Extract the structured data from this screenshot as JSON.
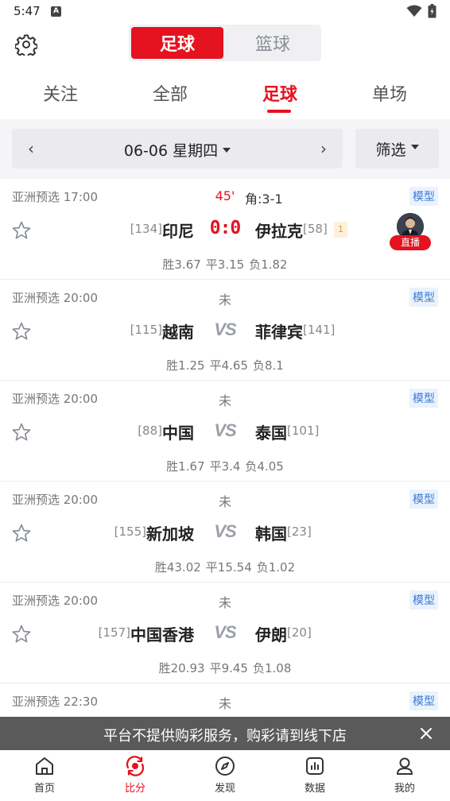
{
  "status_bar": {
    "time": "5:47",
    "notif": "A"
  },
  "header": {
    "sport_toggle": [
      {
        "label": "足球",
        "active": true
      },
      {
        "label": "篮球",
        "active": false
      }
    ]
  },
  "tabs": [
    "关注",
    "全部",
    "足球",
    "单场"
  ],
  "active_tab": "足球",
  "date_bar": {
    "prev": "‹",
    "date": "06-06 星期四",
    "next": "›",
    "filter": "筛选"
  },
  "matches": [
    {
      "league": "亚洲预选 17:00",
      "status": "45'",
      "live": true,
      "corner": "角:3-1",
      "model": "模型",
      "home_rank": "[134]",
      "home": "印尼",
      "score": "0:0",
      "away": "伊拉克",
      "away_rank": "[58]",
      "card": "1",
      "odds": {
        "win": "胜3.67",
        "draw": "平3.15",
        "lose": "负1.82"
      },
      "stream_label": "直播"
    },
    {
      "league": "亚洲预选 20:00",
      "status": "未",
      "model": "模型",
      "home_rank": "[115]",
      "home": "越南",
      "vs": "VS",
      "away": "菲律宾",
      "away_rank": "[141]",
      "odds": {
        "win": "胜1.25",
        "draw": "平4.65",
        "lose": "负8.1"
      }
    },
    {
      "league": "亚洲预选 20:00",
      "status": "未",
      "model": "模型",
      "home_rank": "[88]",
      "home": "中国",
      "vs": "VS",
      "away": "泰国",
      "away_rank": "[101]",
      "odds": {
        "win": "胜1.67",
        "draw": "平3.4",
        "lose": "负4.05"
      }
    },
    {
      "league": "亚洲预选 20:00",
      "status": "未",
      "model": "模型",
      "home_rank": "[155]",
      "home": "新加坡",
      "vs": "VS",
      "away": "韩国",
      "away_rank": "[23]",
      "odds": {
        "win": "胜43.02",
        "draw": "平15.54",
        "lose": "负1.02"
      }
    },
    {
      "league": "亚洲预选 20:00",
      "status": "未",
      "model": "模型",
      "home_rank": "[157]",
      "home": "中国香港",
      "vs": "VS",
      "away": "伊朗",
      "away_rank": "[20]",
      "odds": {
        "win": "胜20.93",
        "draw": "平9.45",
        "lose": "负1.08"
      }
    },
    {
      "league": "亚洲预选 22:30",
      "status": "未",
      "model": "模型"
    }
  ],
  "notice": "平台不提供购彩服务，购彩请到线下店",
  "bottom_nav": [
    {
      "label": "首页",
      "icon": "home-icon"
    },
    {
      "label": "比分",
      "icon": "score-icon",
      "active": true
    },
    {
      "label": "发现",
      "icon": "compass-icon"
    },
    {
      "label": "数据",
      "icon": "data-icon"
    },
    {
      "label": "我的",
      "icon": "profile-icon"
    }
  ],
  "colors": {
    "accent": "#e4131f",
    "model_blue": "#3a7bd5",
    "notice_bg": "#5a5a5a"
  }
}
